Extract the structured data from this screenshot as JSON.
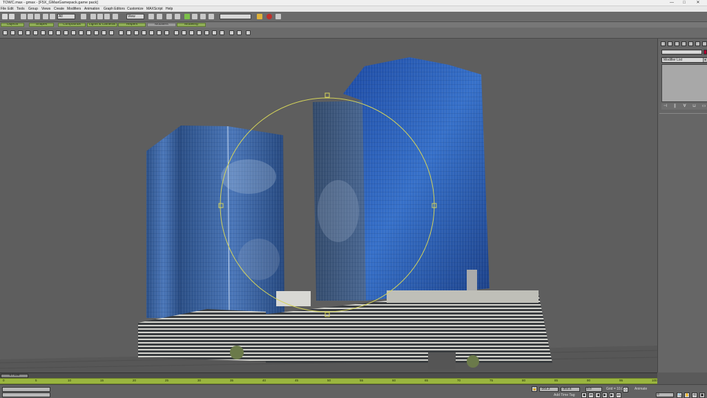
{
  "window": {
    "title": "TOWC.max - gmax - [F5X_GMaxGamepack.game pack]",
    "buttons": [
      "—",
      "□",
      "✕"
    ]
  },
  "menu": [
    "File",
    "Edit",
    "Tools",
    "Group",
    "Views",
    "Create",
    "Modifiers",
    "Animation",
    "Graph Editors",
    "Customize",
    "MAXScript",
    "Help"
  ],
  "toolbar": {
    "selection_filter": "All",
    "reference_coord": "View",
    "named_selection": ""
  },
  "tabs": [
    {
      "label": "Objects"
    },
    {
      "label": "Shapes"
    },
    {
      "label": "Compounds"
    },
    {
      "label": "Lights & Cameras"
    },
    {
      "label": "Helpers"
    },
    {
      "label": "Modifiers"
    },
    {
      "label": "Modeling"
    }
  ],
  "command_panel": {
    "modifier_list": "Modifier List",
    "name_value": "",
    "swatch_color": "#b00030"
  },
  "time": {
    "slider_label": "0 / 100",
    "track_ticks": [
      "0",
      "5",
      "10",
      "15",
      "20",
      "25",
      "30",
      "35",
      "40",
      "45",
      "50",
      "55",
      "60",
      "65",
      "70",
      "75",
      "80",
      "85",
      "90",
      "95",
      "100"
    ]
  },
  "status": {
    "grid": "Grid = 10.0",
    "add_time_tag": "Add Time Tag",
    "animate": "Animate",
    "frame": "0",
    "x_value": "-204.2",
    "y_value": "-304.6",
    "z_value": "0.0"
  },
  "viewport": {
    "background": "#5e5e5e",
    "scene": "city-towers-model"
  }
}
